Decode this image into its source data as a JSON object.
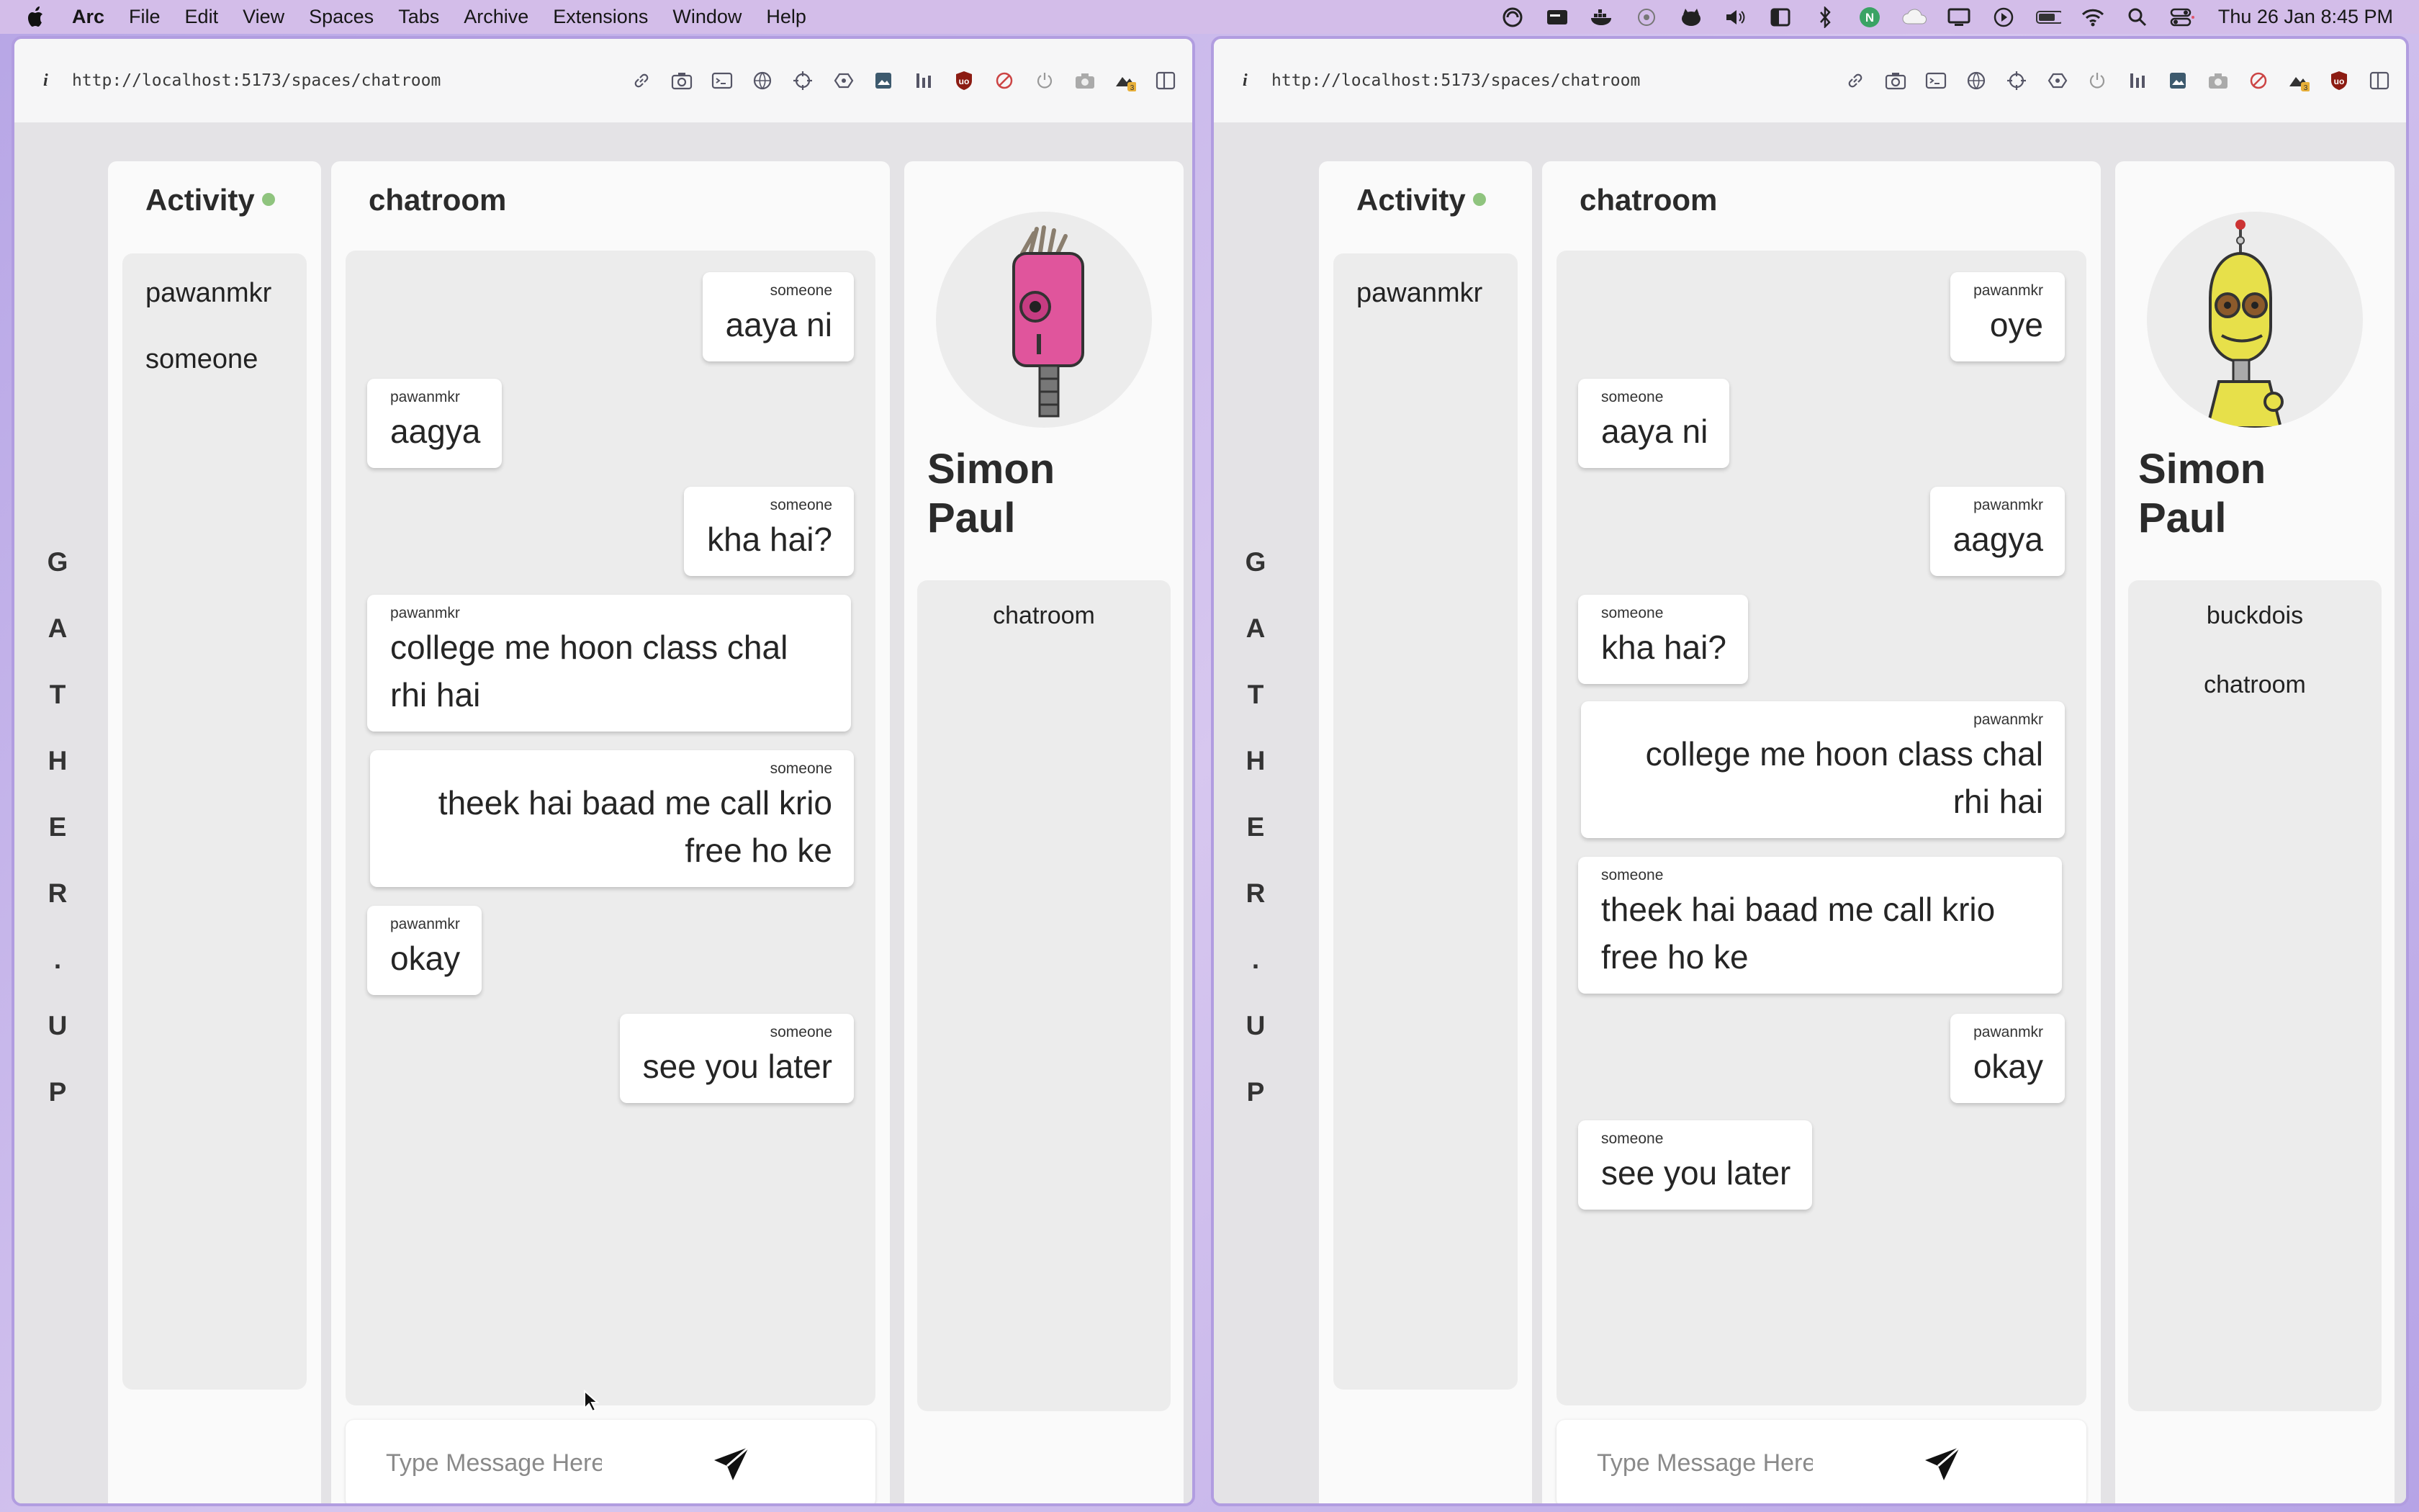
{
  "menubar": {
    "app_name": "Arc",
    "items": [
      "File",
      "Edit",
      "View",
      "Spaces",
      "Tabs",
      "Archive",
      "Extensions",
      "Window",
      "Help"
    ],
    "clock": "Thu 26 Jan  8:45 PM"
  },
  "windows": [
    {
      "url": "http://localhost:5173/spaces/chatroom",
      "brand_letters": [
        "G",
        "A",
        "T",
        "H",
        "E",
        "R",
        ".",
        "U",
        "P"
      ],
      "activity": {
        "title": "Activity",
        "users": [
          "pawanmkr",
          "someone"
        ]
      },
      "chat": {
        "title": "chatroom",
        "messages": [
          {
            "sender": "someone",
            "text": "aaya ni"
          },
          {
            "sender": "pawanmkr",
            "text": "aagya"
          },
          {
            "sender": "someone",
            "text": "kha hai?"
          },
          {
            "sender": "pawanmkr",
            "text": "college me hoon class chal rhi hai"
          },
          {
            "sender": "someone",
            "text": "theek hai baad me call krio free ho ke"
          },
          {
            "sender": "pawanmkr",
            "text": "okay"
          },
          {
            "sender": "someone",
            "text": "see you later"
          }
        ],
        "input_placeholder": "Type Message Here"
      },
      "profile": {
        "name_line1": "Simon",
        "name_line2": "Paul",
        "avatar_icon": "pink-robot-avatar",
        "rooms": [
          "chatroom"
        ]
      }
    },
    {
      "url": "http://localhost:5173/spaces/chatroom",
      "brand_letters": [
        "G",
        "A",
        "T",
        "H",
        "E",
        "R",
        ".",
        "U",
        "P"
      ],
      "activity": {
        "title": "Activity",
        "users": [
          "pawanmkr"
        ]
      },
      "chat": {
        "title": "chatroom",
        "messages": [
          {
            "sender": "pawanmkr",
            "text": "oye"
          },
          {
            "sender": "someone",
            "text": "aaya ni"
          },
          {
            "sender": "pawanmkr",
            "text": "aagya"
          },
          {
            "sender": "someone",
            "text": "kha hai?"
          },
          {
            "sender": "pawanmkr",
            "text": "college me hoon class chal rhi hai"
          },
          {
            "sender": "someone",
            "text": "theek hai baad me call krio free ho ke"
          },
          {
            "sender": "pawanmkr",
            "text": "okay"
          },
          {
            "sender": "someone",
            "text": "see you later"
          }
        ],
        "input_placeholder": "Type Message Here"
      },
      "profile": {
        "name_line1": "Simon",
        "name_line2": "Paul",
        "avatar_icon": "yellow-robot-avatar",
        "rooms": [
          "buckdois",
          "chatroom"
        ]
      }
    }
  ]
}
